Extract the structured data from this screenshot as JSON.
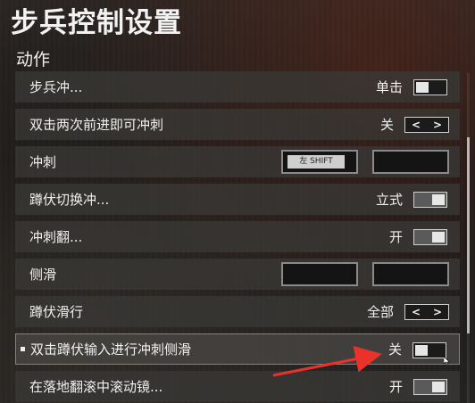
{
  "page": {
    "title": "步兵控制设置"
  },
  "section": {
    "title": "动作"
  },
  "rows": [
    {
      "label": "步兵冲...",
      "type": "toggle",
      "value": "单击",
      "state": "off"
    },
    {
      "label": "双击两次前进即可冲刺",
      "type": "arrows",
      "value": "关"
    },
    {
      "label": "冲刺",
      "type": "keybind",
      "primary_key": "左 SHIFT",
      "secondary_key": ""
    },
    {
      "label": "蹲伏切换冲...",
      "type": "toggle",
      "value": "立式",
      "state": "on"
    },
    {
      "label": "冲刺翻...",
      "type": "toggle",
      "value": "开",
      "state": "on"
    },
    {
      "label": "侧滑",
      "type": "keybind",
      "primary_key": "",
      "secondary_key": ""
    },
    {
      "label": "蹲伏滑行",
      "type": "arrows",
      "value": "全部"
    },
    {
      "label": "双击蹲伏输入进行冲刺侧滑",
      "type": "toggle",
      "value": "关",
      "state": "off",
      "highlighted": true
    },
    {
      "label": "在落地翻滚中滚动镜...",
      "type": "toggle",
      "value": "开",
      "state": "on"
    }
  ],
  "arrow_glyphs": {
    "left": "<",
    "right": ">"
  },
  "colors": {
    "annotation_arrow": "#e8322a",
    "toggle_border": "#cfcfcf"
  }
}
